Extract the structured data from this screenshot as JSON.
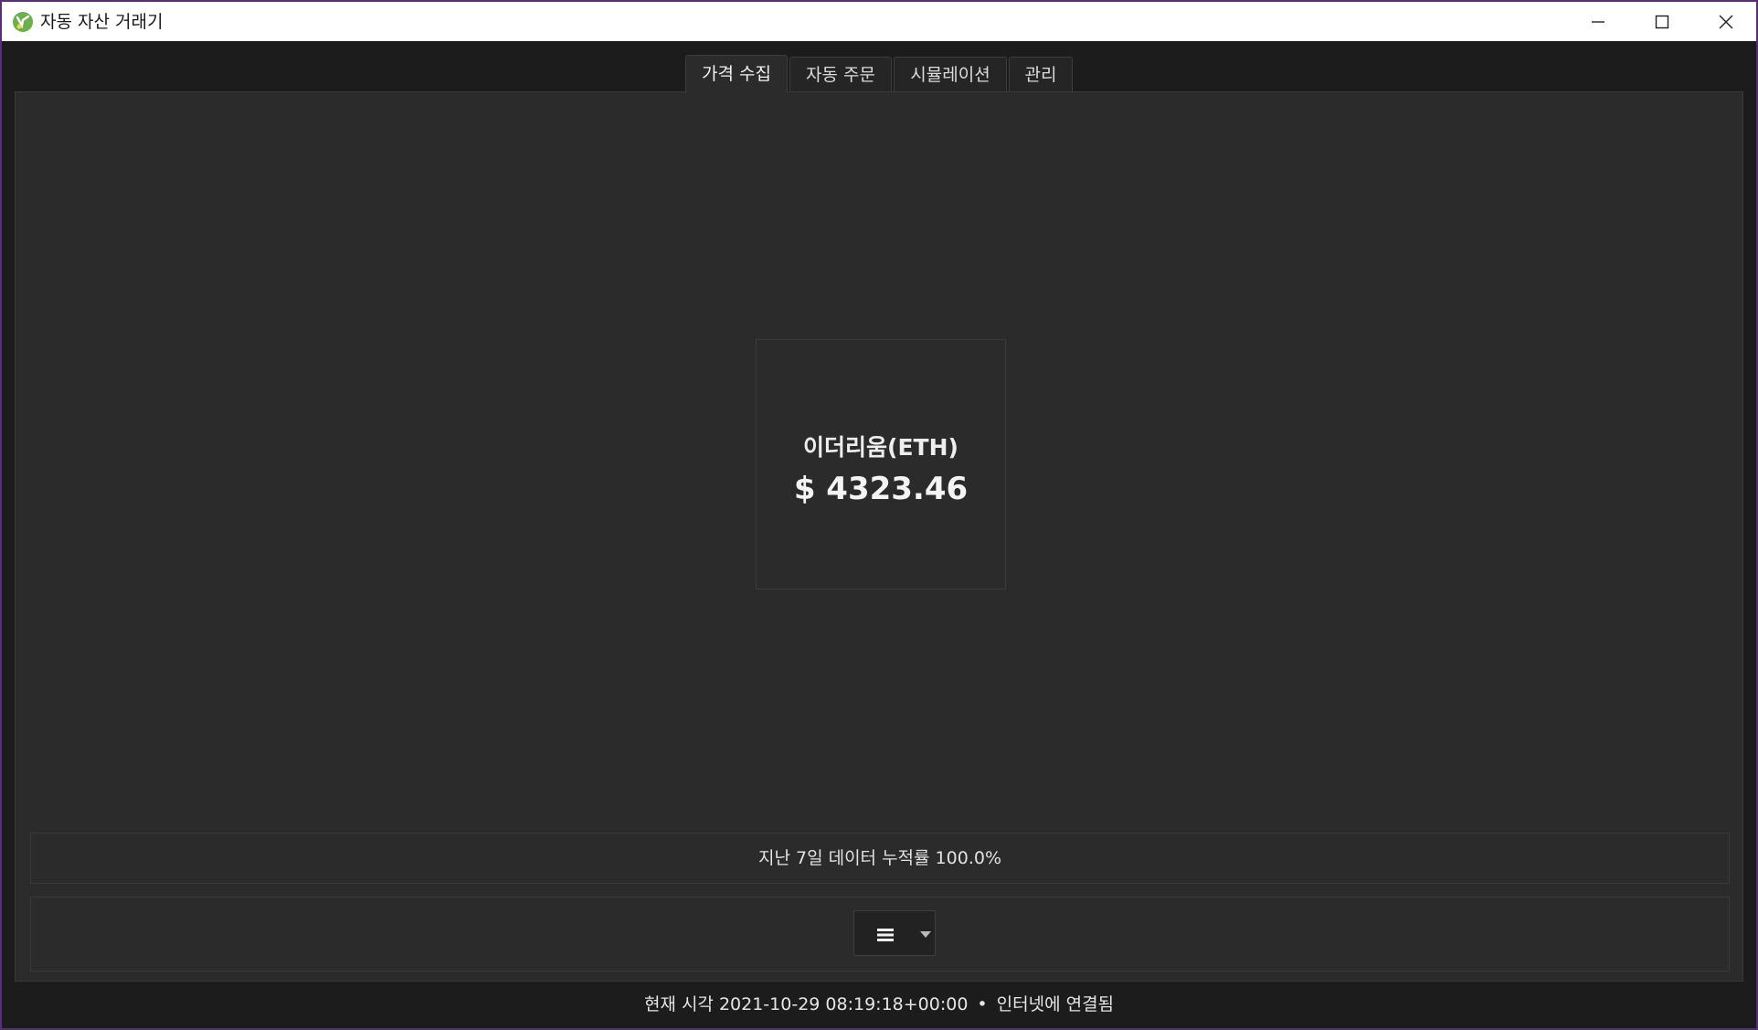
{
  "window": {
    "title": "자동 자산 거래기"
  },
  "tabs": [
    {
      "label": "가격 수집",
      "active": true
    },
    {
      "label": "자동 주문",
      "active": false
    },
    {
      "label": "시뮬레이션",
      "active": false
    },
    {
      "label": "관리",
      "active": false
    }
  ],
  "price_card": {
    "name": "이더리움(ETH)",
    "price": "$ 4323.46"
  },
  "progress": {
    "text": "지난 7일 데이터 누적률 100.0%",
    "value": 1.0
  },
  "menu": {
    "icon": "hamburger-menu-icon"
  },
  "status": {
    "time_label": "현재 시각 2021-10-29 08:19:18+00:00",
    "separator": "•",
    "connection": "인터넷에 연결됨"
  },
  "colors": {
    "background": "#1c1c1c",
    "panel": "#2b2b2b",
    "accent": "#6ab04c"
  }
}
